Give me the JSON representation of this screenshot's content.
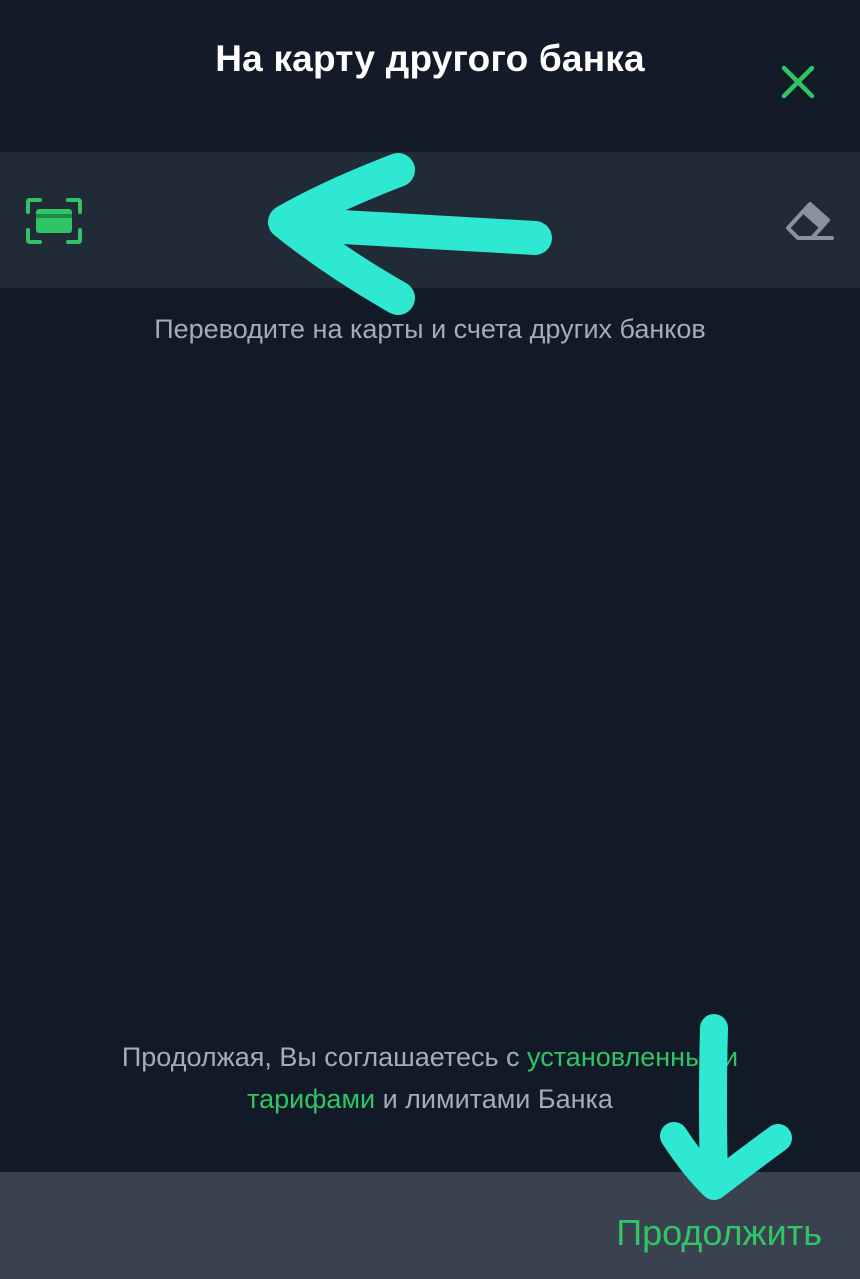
{
  "header": {
    "title": "На карту другого банка",
    "close_icon": "close-icon"
  },
  "card_input": {
    "value": "",
    "placeholder": "",
    "scan_icon": "card-scan-icon",
    "clear_icon": "eraser-icon"
  },
  "hint": "Переводите на карты и счета других банков",
  "terms": {
    "before": "Продолжая, Вы соглашаетесь с ",
    "link": "установленными тарифами",
    "after": " и лимитами Банка"
  },
  "footer": {
    "continue_label": "Продолжить"
  },
  "colors": {
    "accent": "#2fc566",
    "background": "#131a27",
    "input_row": "#212a37",
    "bottom_bar": "#3a4250",
    "hint_text": "#a5acb6",
    "annotation": "#2ee8d2"
  }
}
